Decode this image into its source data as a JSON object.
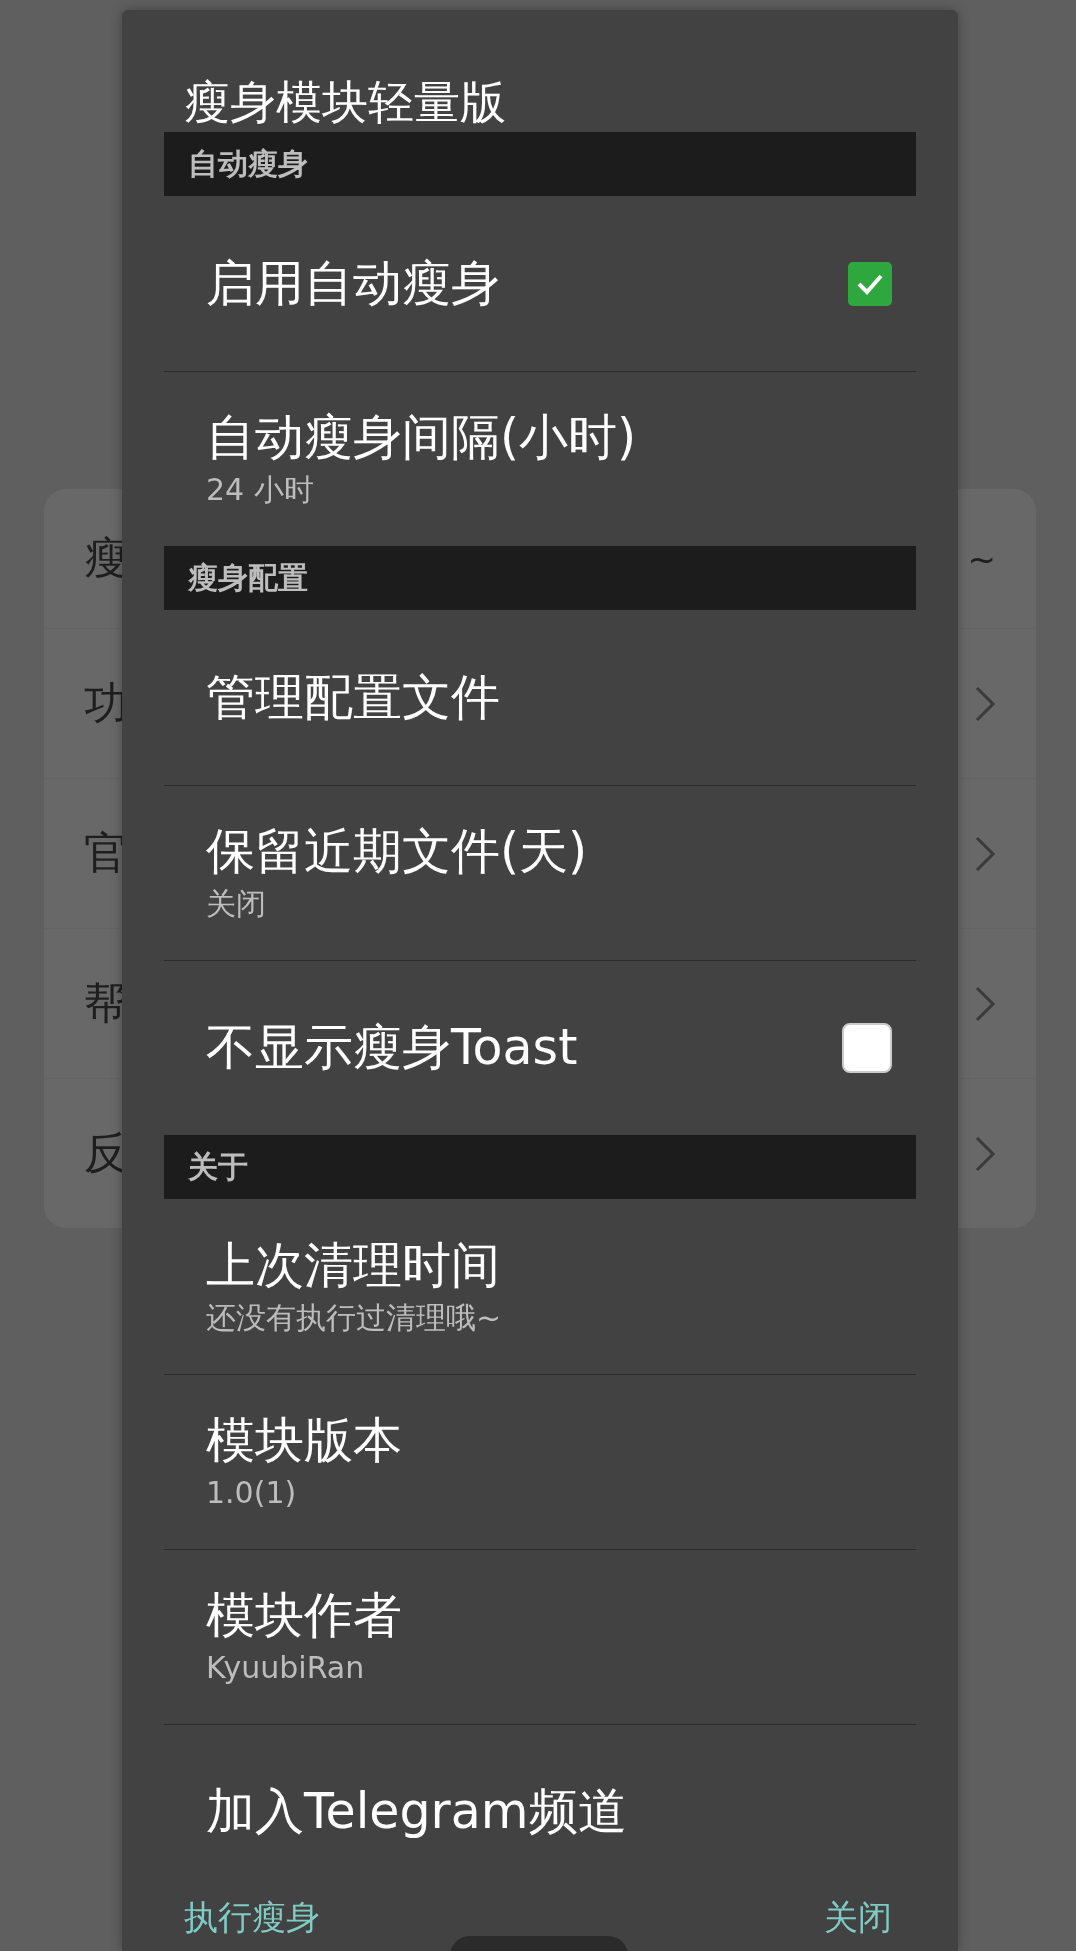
{
  "background_list": {
    "rows": [
      {
        "label": "瘦",
        "kind": "value",
        "value": "~"
      },
      {
        "label": "功",
        "kind": "link"
      },
      {
        "label": "官",
        "kind": "link"
      },
      {
        "label": "帮",
        "kind": "link"
      },
      {
        "label": "反",
        "kind": "link"
      }
    ]
  },
  "dialog": {
    "title": "瘦身模块轻量版",
    "sections": [
      {
        "header": "自动瘦身",
        "items": [
          {
            "title": "启用自动瘦身",
            "kind": "checkbox",
            "checked": true
          },
          {
            "title": "自动瘦身间隔(小时)",
            "summary": "24 小时",
            "kind": "text"
          }
        ]
      },
      {
        "header": "瘦身配置",
        "items": [
          {
            "title": "管理配置文件",
            "kind": "text"
          },
          {
            "title": "保留近期文件(天)",
            "summary": "关闭",
            "kind": "text"
          },
          {
            "title": "不显示瘦身Toast",
            "kind": "checkbox",
            "checked": false
          }
        ]
      },
      {
        "header": "关于",
        "items": [
          {
            "title": "上次清理时间",
            "summary": "还没有执行过清理哦~",
            "kind": "text"
          },
          {
            "title": "模块版本",
            "summary": "1.0(1)",
            "kind": "text"
          },
          {
            "title": "模块作者",
            "summary": "KyuubiRan",
            "kind": "text"
          },
          {
            "title": "加入Telegram频道",
            "kind": "text"
          }
        ]
      }
    ],
    "buttons": [
      {
        "label": "执行瘦身"
      },
      {
        "label": "关闭"
      }
    ]
  }
}
